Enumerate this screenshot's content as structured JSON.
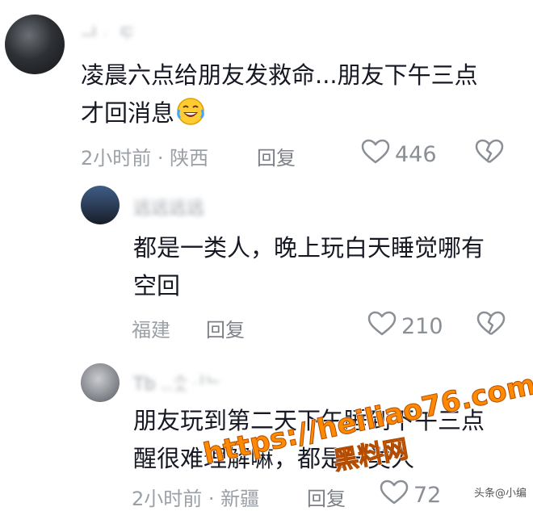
{
  "comments": [
    {
      "username": "ᆜᆞ ᄃᆞ",
      "text": "凌晨六点给朋友发救命...朋友下午三点才回消息",
      "emoji": "laughing-crying-emoji",
      "time": "2小时前 · 陕西",
      "reply_label": "回复",
      "likes": "446"
    },
    {
      "username": "远远远远",
      "text": "都是一类人，晚上玩白天睡觉哪有空回",
      "location": "福建",
      "reply_label": "回复",
      "likes": "210"
    },
    {
      "username": "Tb ..ᄉᆢᆺᆡᄂ",
      "text": "朋友玩到第二天下午睡到下午三点醒很难理解嘛，都是一类人",
      "time": "2小时前 · 新疆",
      "reply_label": "回复",
      "likes": "72"
    }
  ],
  "watermark": {
    "url": "https://heiliao76.com",
    "label": "黑料网"
  },
  "source_tag": "头条@小编",
  "colors": {
    "text": "#161823",
    "meta": "#9aa0a6",
    "watermark": "#ff8a00"
  }
}
